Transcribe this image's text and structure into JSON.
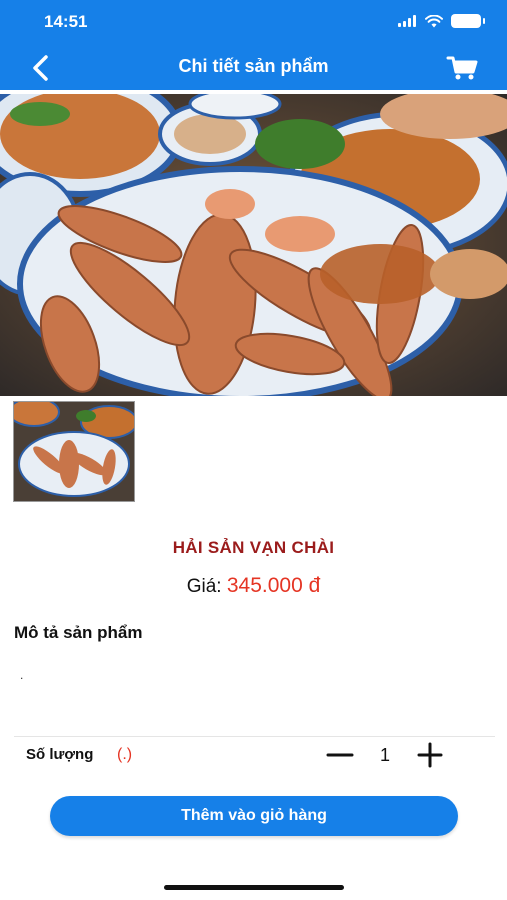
{
  "status_bar": {
    "time": "14:51"
  },
  "header": {
    "title": "Chi tiết sản phẩm"
  },
  "product": {
    "name": "HẢI SẢN VẠN CHÀI",
    "price_label": "Giá:",
    "price_value": "345.000 đ",
    "description_title": "Mô tả sản phẩm",
    "description_text": "."
  },
  "quantity": {
    "label": "Số lượng",
    "note": "(.)",
    "value": "1"
  },
  "actions": {
    "add_to_cart_label": "Thêm vào giỏ hàng"
  },
  "colors": {
    "primary": "#1680e8",
    "product_name": "#9b1c1c",
    "price": "#e53524"
  },
  "icons": {
    "back": "chevron-left-icon",
    "cart": "cart-icon",
    "minus": "minus-icon",
    "plus": "plus-icon"
  }
}
